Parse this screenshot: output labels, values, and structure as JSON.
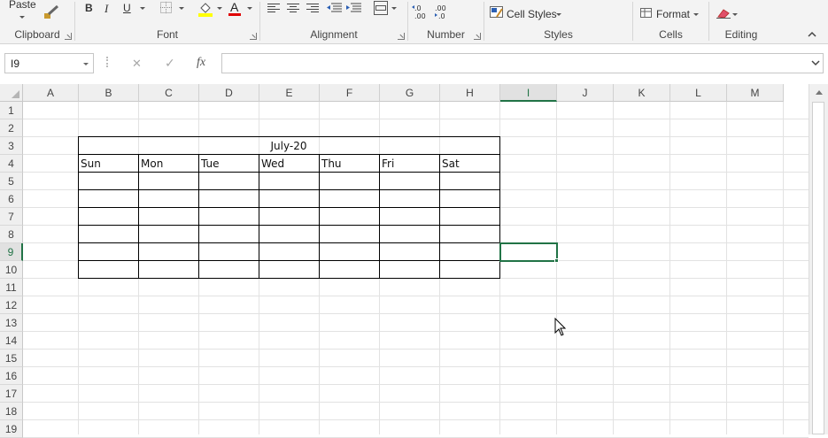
{
  "ribbon": {
    "paste_label": "Paste",
    "groups": {
      "clipboard": "Clipboard",
      "font": "Font",
      "alignment": "Alignment",
      "number": "Number",
      "styles": "Styles",
      "cells": "Cells",
      "editing": "Editing"
    },
    "bold": "B",
    "italic": "I",
    "underline": "U",
    "font_color_letter": "A",
    "cell_styles_label": "Cell Styles",
    "format_label": "Format",
    "increase_decimal": "←.0\n.00",
    "decrease_decimal": ".00\n→.0",
    "colors": {
      "highlight": "#ffff00",
      "font_color": "#e00000",
      "accent": "#217346"
    }
  },
  "formula_bar": {
    "name_box": "I9",
    "cancel": "✕",
    "enter": "✓",
    "fx": "fx",
    "content": ""
  },
  "sheet": {
    "columns": [
      "A",
      "B",
      "C",
      "D",
      "E",
      "F",
      "G",
      "H",
      "I",
      "J",
      "K",
      "L",
      "M"
    ],
    "rows": [
      "1",
      "2",
      "3",
      "4",
      "5",
      "6",
      "7",
      "8",
      "9",
      "10",
      "11",
      "12",
      "13",
      "14",
      "15",
      "16",
      "17",
      "18",
      "19"
    ],
    "selected_cell": "I9",
    "calendar_title": "July-20",
    "days": [
      "Sun",
      "Mon",
      "Tue",
      "Wed",
      "Thu",
      "Fri",
      "Sat"
    ]
  },
  "icons": {
    "paste": "clipboard-icon",
    "format_painter": "paintbrush-icon",
    "borders": "borders-icon",
    "fill": "paint-bucket-icon",
    "font_color": "font-color-icon",
    "align": "align-icon",
    "indent": "indent-icon",
    "merge": "merge-icon",
    "cell_styles": "cell-styles-icon",
    "clear": "eraser-icon",
    "collapse": "chevron-up-icon",
    "cursor": "mouse-pointer-icon"
  }
}
